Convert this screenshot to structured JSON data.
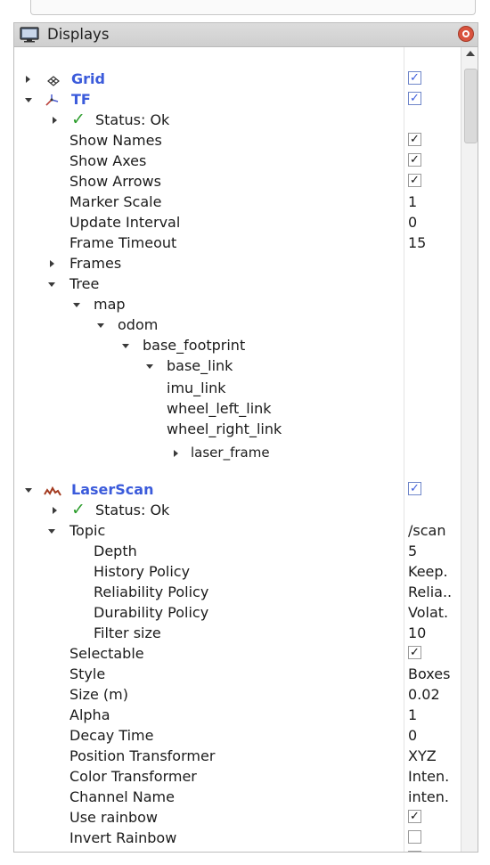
{
  "panel": {
    "title": "Displays"
  },
  "rows": [
    {
      "name": "display-grid",
      "label": "Grid",
      "display": true,
      "checked": true,
      "icon": "grid-icon",
      "expander": "closed"
    },
    {
      "name": "display-tf",
      "label": "TF",
      "display": true,
      "checked": true,
      "icon": "tf-icon",
      "expander": "open"
    },
    {
      "name": "tf-status",
      "label": "Status: Ok",
      "status": true,
      "expander": "closed"
    },
    {
      "name": "tf-show-names",
      "label": "Show Names",
      "checked": true
    },
    {
      "name": "tf-show-axes",
      "label": "Show Axes",
      "checked": true
    },
    {
      "name": "tf-show-arrows",
      "label": "Show Arrows",
      "checked": true
    },
    {
      "name": "tf-marker-scale",
      "label": "Marker Scale",
      "value": "1"
    },
    {
      "name": "tf-update-interval",
      "label": "Update Interval",
      "value": "0"
    },
    {
      "name": "tf-frame-timeout",
      "label": "Frame Timeout",
      "value": "15"
    },
    {
      "name": "tf-frames",
      "label": "Frames",
      "expander": "closed"
    },
    {
      "name": "tf-tree",
      "label": "Tree",
      "expander": "open"
    },
    {
      "name": "tree-map",
      "label": "map",
      "expander": "open"
    },
    {
      "name": "tree-odom",
      "label": "odom",
      "expander": "open"
    },
    {
      "name": "tree-base-footprint",
      "label": "base_footprint",
      "expander": "open"
    },
    {
      "name": "tree-base-link",
      "label": "base_link",
      "expander": "open"
    },
    {
      "name": "tree-imu-link",
      "label": "imu_link"
    },
    {
      "name": "tree-wheel-left-link",
      "label": "wheel_left_link"
    },
    {
      "name": "tree-wheel-right-link",
      "label": "wheel_right_link"
    },
    {
      "name": "tree-laser-frame",
      "label": "laser_frame",
      "expander": "closed",
      "small": true
    },
    {
      "name": "display-laserscan",
      "label": "LaserScan",
      "display": true,
      "checked": true,
      "icon": "laserscan-icon",
      "expander": "open"
    },
    {
      "name": "laserscan-status",
      "label": "Status: Ok",
      "status": true,
      "expander": "closed"
    },
    {
      "name": "laserscan-topic",
      "label": "Topic",
      "value": "/scan",
      "expander": "open"
    },
    {
      "name": "topic-depth",
      "label": "Depth",
      "value": "5"
    },
    {
      "name": "topic-history-policy",
      "label": "History Policy",
      "value": "Keep."
    },
    {
      "name": "topic-reliability-policy",
      "label": "Reliability Policy",
      "value": "Relia.."
    },
    {
      "name": "topic-durability-policy",
      "label": "Durability Policy",
      "value": "Volat."
    },
    {
      "name": "topic-filter-size",
      "label": "Filter size",
      "value": "10"
    },
    {
      "name": "laserscan-selectable",
      "label": "Selectable",
      "checked": true
    },
    {
      "name": "laserscan-style",
      "label": "Style",
      "value": "Boxes"
    },
    {
      "name": "laserscan-size",
      "label": "Size (m)",
      "value": "0.02"
    },
    {
      "name": "laserscan-alpha",
      "label": "Alpha",
      "value": "1"
    },
    {
      "name": "laserscan-decay-time",
      "label": "Decay Time",
      "value": "0"
    },
    {
      "name": "laserscan-position-transformer",
      "label": "Position Transformer",
      "value": "XYZ"
    },
    {
      "name": "laserscan-color-transformer",
      "label": "Color Transformer",
      "value": "Inten."
    },
    {
      "name": "laserscan-channel-name",
      "label": "Channel Name",
      "value": "inten."
    },
    {
      "name": "laserscan-use-rainbow",
      "label": "Use rainbow",
      "checked": true
    },
    {
      "name": "laserscan-invert-rainbow",
      "label": "Invert Rainbow",
      "checked": false
    },
    {
      "name": "laserscan-autocompute-intensity",
      "label": "Autocompute Intensity Bounds",
      "checked": true
    }
  ],
  "check_mark": "✓",
  "colors": {
    "display_name": "#3b5bdb",
    "status_check": "#2e9e2e",
    "close_button": "#d9533e"
  }
}
